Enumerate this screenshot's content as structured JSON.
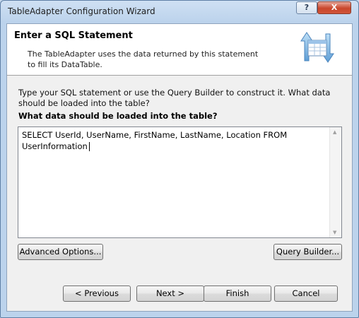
{
  "window": {
    "title": "TableAdapter Configuration Wizard",
    "help_label": "?",
    "close_label": "X"
  },
  "header": {
    "title": "Enter a SQL Statement",
    "description": "The TableAdapter uses the data returned by this statement to fill its DataTable."
  },
  "body": {
    "instruction": "Type your SQL statement or use the Query Builder to construct it. What data should be loaded into the table?",
    "query_label": "What data should be loaded into the table?",
    "sql_text": "SELECT UserId, UserName, FirstName, LastName, Location FROM UserInformation"
  },
  "buttons": {
    "advanced": "Advanced Options...",
    "query_builder": "Query Builder...",
    "previous": "< Previous",
    "next": "Next >",
    "finish": "Finish",
    "cancel": "Cancel"
  }
}
